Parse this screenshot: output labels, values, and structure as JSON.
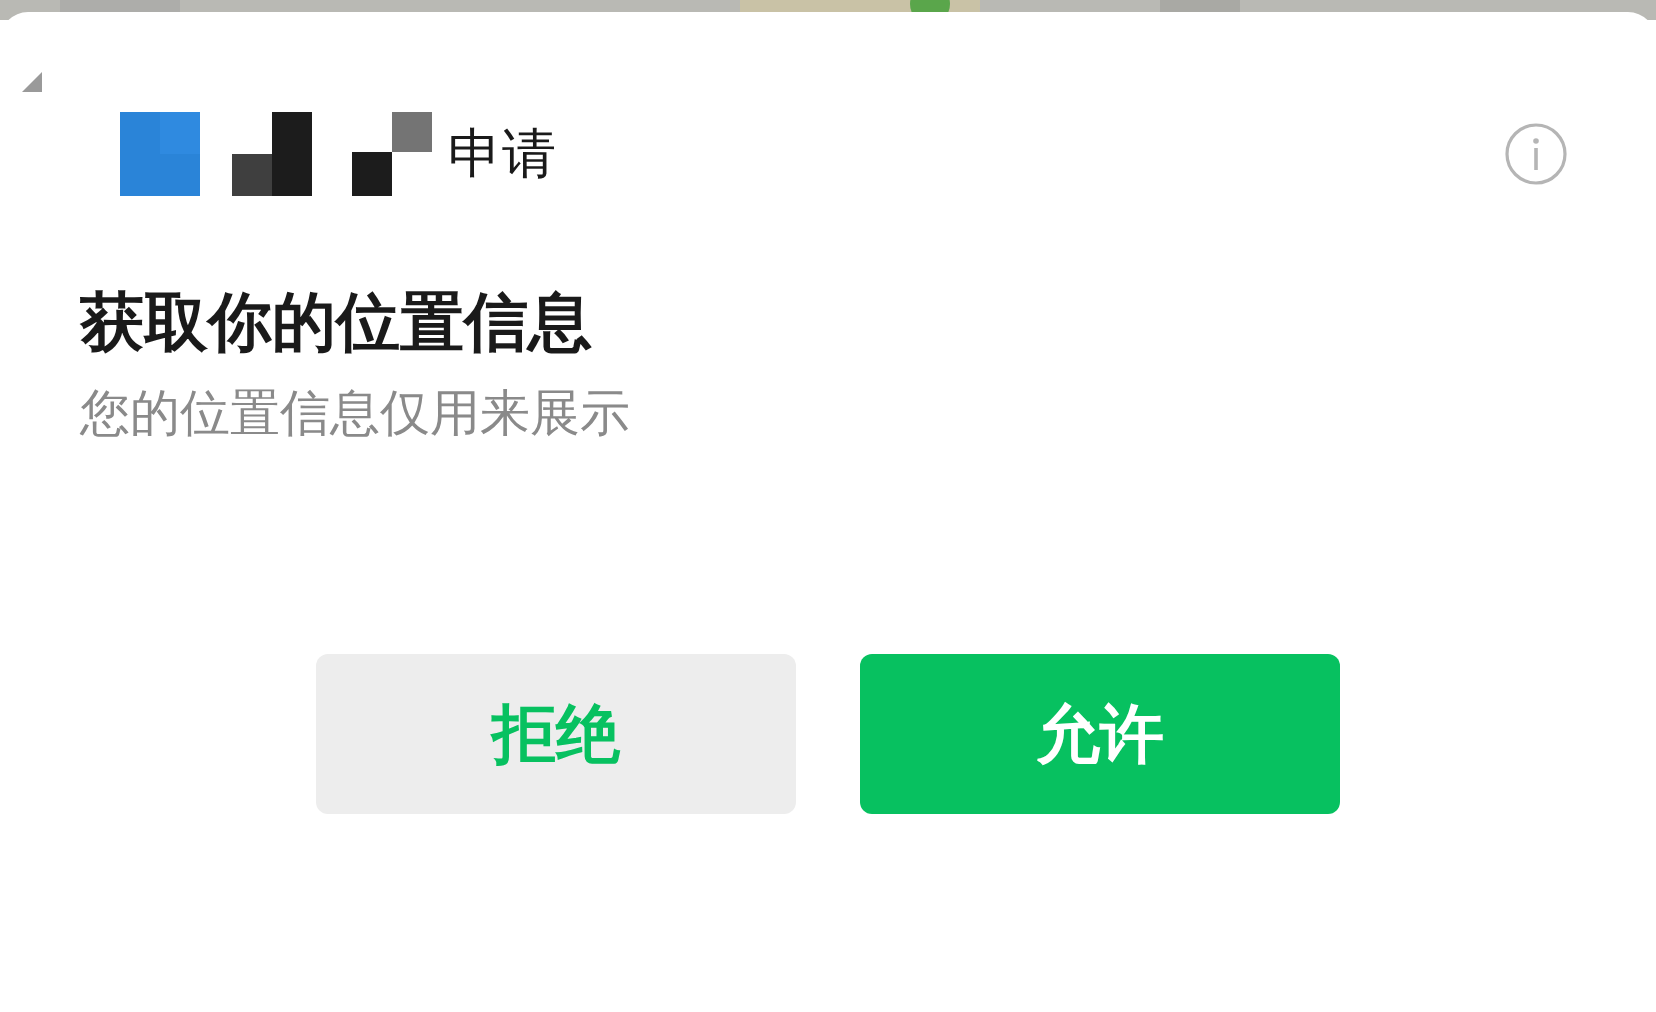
{
  "header": {
    "title": "申请"
  },
  "heading": "获取你的位置信息",
  "description": "您的位置信息仅用来展示",
  "buttons": [
    {
      "label": "拒绝",
      "kind": "secondary"
    },
    {
      "label": "允许",
      "kind": "primary"
    }
  ]
}
